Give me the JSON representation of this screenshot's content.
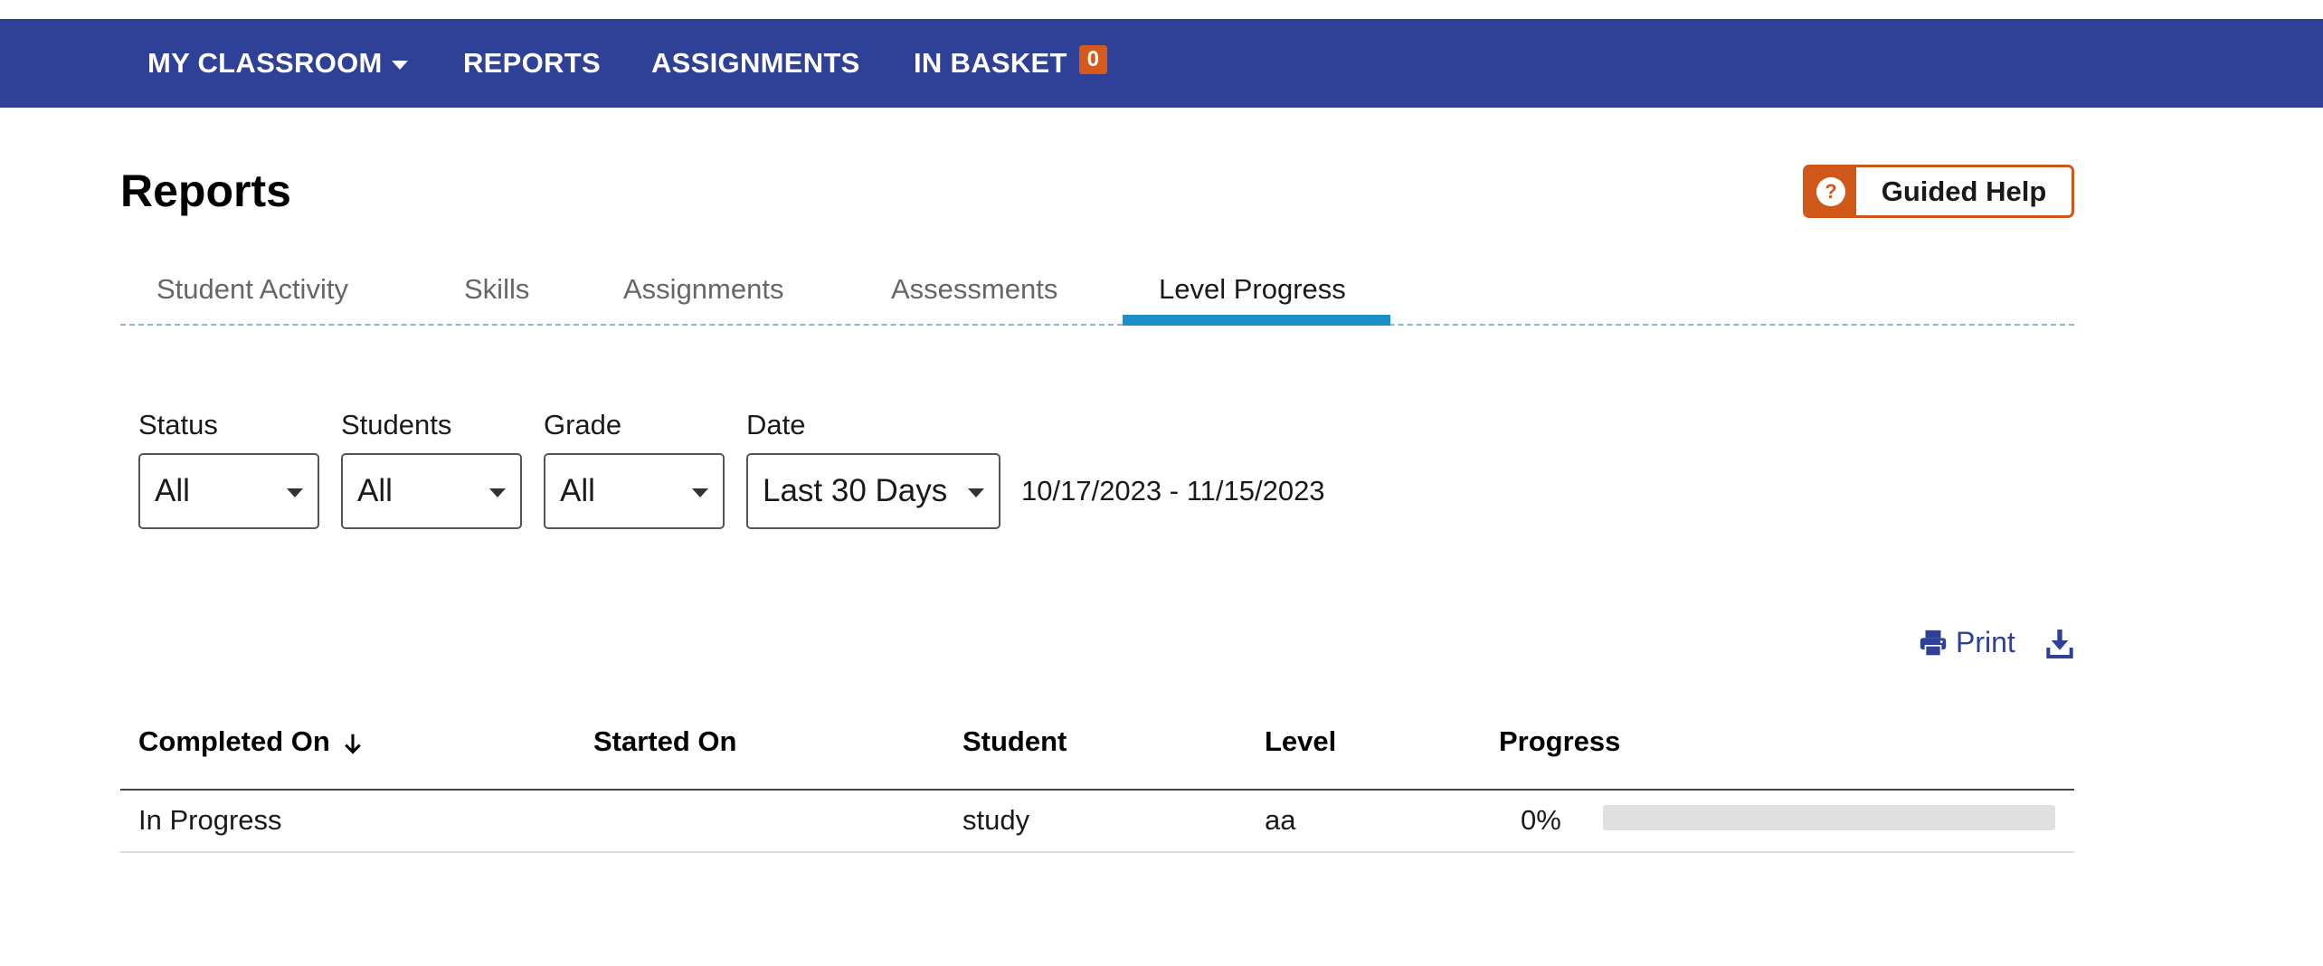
{
  "nav": {
    "my_classroom": "MY CLASSROOM",
    "reports": "REPORTS",
    "assignments": "ASSIGNMENTS",
    "in_basket": "IN BASKET",
    "basket_count": "0"
  },
  "header": {
    "title": "Reports",
    "guided_help": "Guided Help",
    "guided_help_icon": "?"
  },
  "tabs": [
    {
      "label": "Student Activity"
    },
    {
      "label": "Skills"
    },
    {
      "label": "Assignments"
    },
    {
      "label": "Assessments"
    },
    {
      "label": "Level Progress",
      "active": true
    }
  ],
  "filters": {
    "status": {
      "label": "Status",
      "value": "All"
    },
    "students": {
      "label": "Students",
      "value": "All"
    },
    "grade": {
      "label": "Grade",
      "value": "All"
    },
    "date": {
      "label": "Date",
      "value": "Last 30 Days"
    },
    "date_range": "10/17/2023 - 11/15/2023"
  },
  "actions": {
    "print": "Print"
  },
  "table": {
    "columns": [
      "Completed On",
      "Started On",
      "Student",
      "Level",
      "Progress"
    ],
    "rows": [
      {
        "completed_on": "In Progress",
        "started_on": "",
        "student": "study",
        "level": "aa",
        "progress_label": "0%",
        "progress": 0
      }
    ]
  },
  "colors": {
    "nav_bg": "#2f4097",
    "accent_orange": "#cf5718",
    "tab_active": "#1d8fc8"
  }
}
